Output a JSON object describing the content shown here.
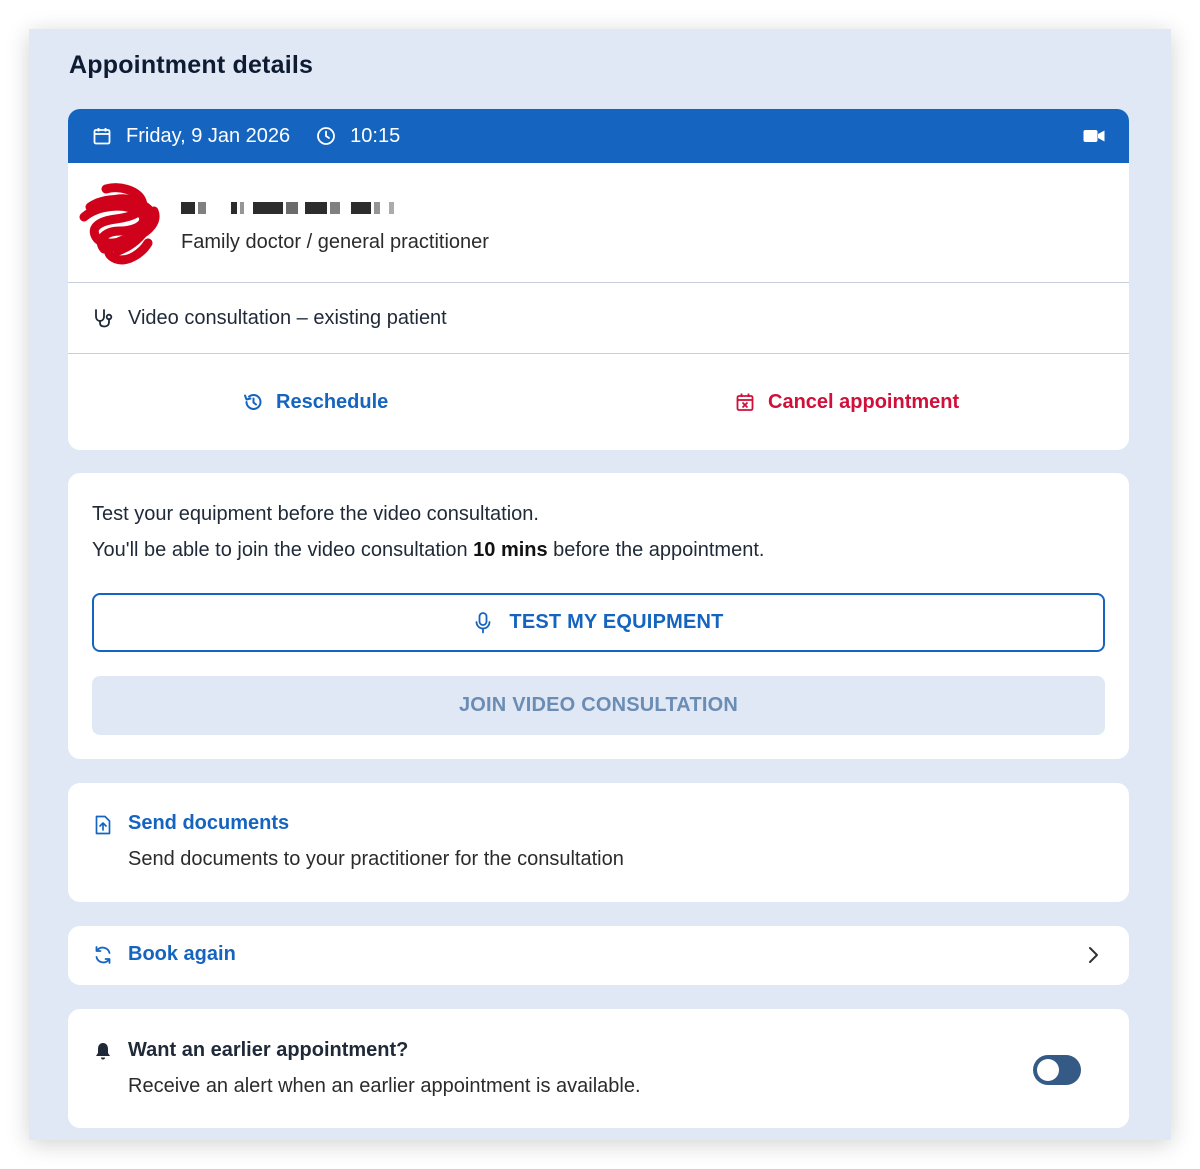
{
  "page": {
    "title": "Appointment details"
  },
  "appointment": {
    "date": "Friday, 9 Jan 2026",
    "time": "10:15",
    "practitioner": {
      "name": "",
      "specialty": "Family doctor / general practitioner"
    },
    "service": "Video consultation – existing patient",
    "actions": {
      "reschedule": "Reschedule",
      "cancel": "Cancel appointment"
    }
  },
  "equipment": {
    "line1": "Test your equipment before the video consultation.",
    "line2_prefix": "You'll be able to join the video consultation ",
    "line2_bold": "10 mins",
    "line2_suffix": " before the appointment.",
    "test_button": "TEST MY EQUIPMENT",
    "join_button": "JOIN VIDEO CONSULTATION"
  },
  "documents": {
    "title": "Send documents",
    "description": "Send documents to your practitioner for the consultation"
  },
  "book_again": {
    "label": "Book again"
  },
  "earlier": {
    "title": "Want an earlier appointment?",
    "description": "Receive an alert when an earlier appointment is available.",
    "toggle_on": false
  },
  "colors": {
    "primary": "#1565c0",
    "danger": "#d0103a",
    "panel_bg": "#dfe8f4",
    "toggle_off": "#355a85"
  },
  "icons": {
    "date": "calendar-icon",
    "time": "clock-icon",
    "video": "video-camera-icon",
    "service": "stethoscope-icon",
    "reschedule": "history-icon",
    "cancel": "calendar-x-icon",
    "mic": "microphone-icon",
    "documents": "file-upload-icon",
    "book_again": "refresh-icon",
    "chevron": "chevron-right-icon",
    "bell": "bell-icon"
  }
}
